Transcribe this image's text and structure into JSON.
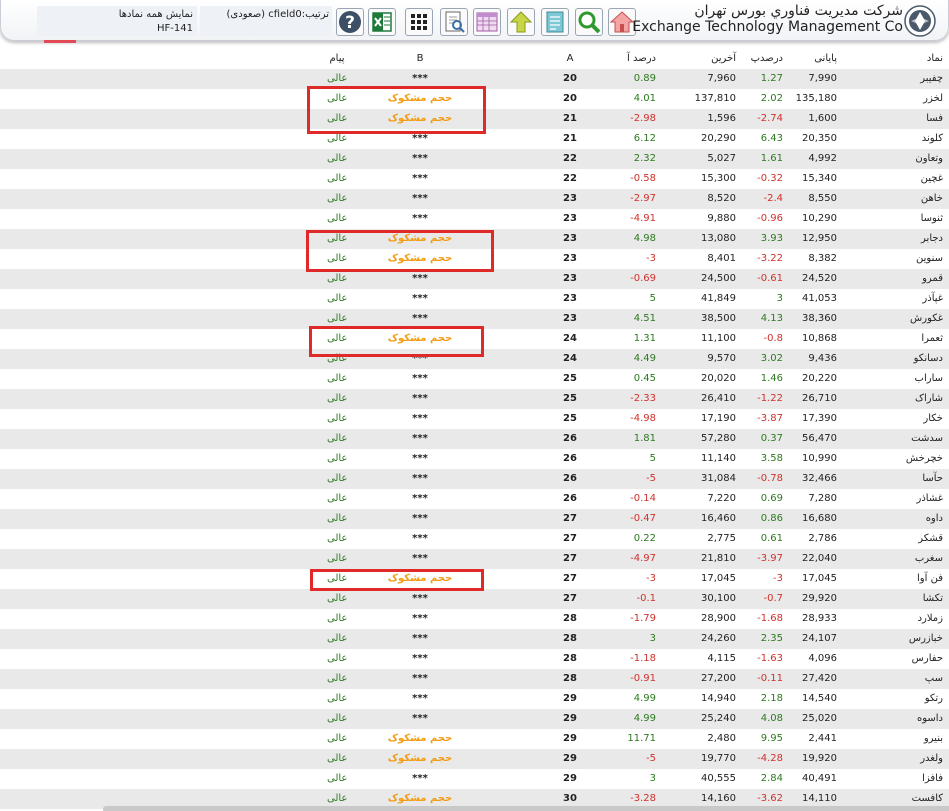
{
  "header": {
    "company_fa": "شرکت مديريت فناوري بورس تهران",
    "company_en": "Exchange Technology Management Co",
    "show_all_label": "نمایش همه نمادها",
    "report_code": "HF-141",
    "sort_label": "ترتیب:cfield0 (صعودی)",
    "toolbar": [
      "help-icon",
      "excel-icon",
      "grid-icon",
      "print-preview-icon",
      "calendar-table-icon",
      "upload-icon",
      "notes-icon",
      "search-icon",
      "home-icon"
    ]
  },
  "columns": {
    "symbol": "نماد",
    "close": "پایانی",
    "close_pct": "درصدپ",
    "last": "آخرین",
    "last_pct": "درصد آ",
    "a": "A",
    "b": "B",
    "message": "پیام"
  },
  "colors": {
    "positive": "#2d7a1f",
    "negative": "#d0312d",
    "flag": "#f39c12",
    "highlight": "#e02a2a"
  },
  "rows": [
    {
      "symbol": "چفیبر",
      "close": "7,990",
      "close_pct": "1.27",
      "last": "7,960",
      "last_pct": "0.89",
      "a": "20",
      "b": "***",
      "message": "عالی"
    },
    {
      "symbol": "لخزر",
      "close": "135,180",
      "close_pct": "2.02",
      "last": "137,810",
      "last_pct": "4.01",
      "a": "20",
      "b": "حجم مشکوک",
      "message": "عالی"
    },
    {
      "symbol": "فسا",
      "close": "1,600",
      "close_pct": "-2.74",
      "last": "1,596",
      "last_pct": "-2.98",
      "a": "21",
      "b": "حجم مشکوک",
      "message": "عالی"
    },
    {
      "symbol": "کلوند",
      "close": "20,350",
      "close_pct": "6.43",
      "last": "20,290",
      "last_pct": "6.12",
      "a": "21",
      "b": "***",
      "message": "عالی"
    },
    {
      "symbol": "وتعاون",
      "close": "4,992",
      "close_pct": "1.61",
      "last": "5,027",
      "last_pct": "2.32",
      "a": "22",
      "b": "***",
      "message": "عالی"
    },
    {
      "symbol": "غچین",
      "close": "15,340",
      "close_pct": "-0.32",
      "last": "15,300",
      "last_pct": "-0.58",
      "a": "22",
      "b": "***",
      "message": "عالی"
    },
    {
      "symbol": "خاهن",
      "close": "8,550",
      "close_pct": "-2.4",
      "last": "8,520",
      "last_pct": "-2.97",
      "a": "23",
      "b": "***",
      "message": "عالی"
    },
    {
      "symbol": "ثنوسا",
      "close": "10,290",
      "close_pct": "-0.96",
      "last": "9,880",
      "last_pct": "-4.91",
      "a": "23",
      "b": "***",
      "message": "عالی"
    },
    {
      "symbol": "دجابر",
      "close": "12,950",
      "close_pct": "3.93",
      "last": "13,080",
      "last_pct": "4.98",
      "a": "23",
      "b": "حجم مشکوک",
      "message": "عالی"
    },
    {
      "symbol": "سنوین",
      "close": "8,382",
      "close_pct": "-3.22",
      "last": "8,401",
      "last_pct": "-3",
      "a": "23",
      "b": "حجم مشکوک",
      "message": "عالی"
    },
    {
      "symbol": "قمرو",
      "close": "24,520",
      "close_pct": "-0.61",
      "last": "24,500",
      "last_pct": "-0.69",
      "a": "23",
      "b": "***",
      "message": "عالی"
    },
    {
      "symbol": "غپآذر",
      "close": "41,053",
      "close_pct": "3",
      "last": "41,849",
      "last_pct": "5",
      "a": "23",
      "b": "***",
      "message": "عالی"
    },
    {
      "symbol": "غکورش",
      "close": "38,360",
      "close_pct": "4.13",
      "last": "38,500",
      "last_pct": "4.51",
      "a": "23",
      "b": "***",
      "message": "عالی"
    },
    {
      "symbol": "ثعمرا",
      "close": "10,868",
      "close_pct": "-0.8",
      "last": "11,100",
      "last_pct": "1.31",
      "a": "24",
      "b": "حجم مشکوک",
      "message": "عالی"
    },
    {
      "symbol": "دسانکو",
      "close": "9,436",
      "close_pct": "3.02",
      "last": "9,570",
      "last_pct": "4.49",
      "a": "24",
      "b": "***",
      "message": "عالی"
    },
    {
      "symbol": "ساراب",
      "close": "20,220",
      "close_pct": "1.46",
      "last": "20,020",
      "last_pct": "0.45",
      "a": "25",
      "b": "***",
      "message": "عالی"
    },
    {
      "symbol": "شاراک",
      "close": "26,710",
      "close_pct": "-1.22",
      "last": "26,410",
      "last_pct": "-2.33",
      "a": "25",
      "b": "***",
      "message": "عالی"
    },
    {
      "symbol": "خکار",
      "close": "17,390",
      "close_pct": "-3.87",
      "last": "17,190",
      "last_pct": "-4.98",
      "a": "25",
      "b": "***",
      "message": "عالی"
    },
    {
      "symbol": "سدشت",
      "close": "56,470",
      "close_pct": "0.37",
      "last": "57,280",
      "last_pct": "1.81",
      "a": "26",
      "b": "***",
      "message": "عالی"
    },
    {
      "symbol": "خچرخش",
      "close": "10,990",
      "close_pct": "3.58",
      "last": "11,140",
      "last_pct": "5",
      "a": "26",
      "b": "***",
      "message": "عالی"
    },
    {
      "symbol": "حآسا",
      "close": "32,466",
      "close_pct": "-0.78",
      "last": "31,084",
      "last_pct": "-5",
      "a": "26",
      "b": "***",
      "message": "عالی"
    },
    {
      "symbol": "غشاذر",
      "close": "7,280",
      "close_pct": "0.69",
      "last": "7,220",
      "last_pct": "-0.14",
      "a": "26",
      "b": "***",
      "message": "عالی"
    },
    {
      "symbol": "داوه",
      "close": "16,680",
      "close_pct": "0.86",
      "last": "16,460",
      "last_pct": "-0.47",
      "a": "27",
      "b": "***",
      "message": "عالی"
    },
    {
      "symbol": "قشکر",
      "close": "2,786",
      "close_pct": "0.61",
      "last": "2,775",
      "last_pct": "0.22",
      "a": "27",
      "b": "***",
      "message": "عالی"
    },
    {
      "symbol": "سغرب",
      "close": "22,040",
      "close_pct": "-3.97",
      "last": "21,810",
      "last_pct": "-4.97",
      "a": "27",
      "b": "***",
      "message": "عالی"
    },
    {
      "symbol": "فن آوا",
      "close": "17,045",
      "close_pct": "-3",
      "last": "17,045",
      "last_pct": "-3",
      "a": "27",
      "b": "حجم مشکوک",
      "message": "عالی"
    },
    {
      "symbol": "تکشا",
      "close": "29,920",
      "close_pct": "-0.7",
      "last": "30,100",
      "last_pct": "-0.1",
      "a": "27",
      "b": "***",
      "message": "عالی"
    },
    {
      "symbol": "زملارد",
      "close": "28,933",
      "close_pct": "-1.68",
      "last": "28,900",
      "last_pct": "-1.79",
      "a": "28",
      "b": "***",
      "message": "عالی"
    },
    {
      "symbol": "خبازرس",
      "close": "24,107",
      "close_pct": "2.35",
      "last": "24,260",
      "last_pct": "3",
      "a": "28",
      "b": "***",
      "message": "عالی"
    },
    {
      "symbol": "حفارس",
      "close": "4,096",
      "close_pct": "-1.63",
      "last": "4,115",
      "last_pct": "-1.18",
      "a": "28",
      "b": "***",
      "message": "عالی"
    },
    {
      "symbol": "سپ",
      "close": "27,420",
      "close_pct": "-0.11",
      "last": "27,200",
      "last_pct": "-0.91",
      "a": "28",
      "b": "***",
      "message": "عالی"
    },
    {
      "symbol": "رتکو",
      "close": "14,540",
      "close_pct": "2.18",
      "last": "14,940",
      "last_pct": "4.99",
      "a": "29",
      "b": "***",
      "message": "عالی"
    },
    {
      "symbol": "داسوه",
      "close": "25,020",
      "close_pct": "4.08",
      "last": "25,240",
      "last_pct": "4.99",
      "a": "29",
      "b": "***",
      "message": "عالی"
    },
    {
      "symbol": "بنیرو",
      "close": "2,441",
      "close_pct": "9.95",
      "last": "2,480",
      "last_pct": "11.71",
      "a": "29",
      "b": "حجم مشکوک",
      "message": "عالی"
    },
    {
      "symbol": "ولغدر",
      "close": "19,920",
      "close_pct": "-4.28",
      "last": "19,770",
      "last_pct": "-5",
      "a": "29",
      "b": "حجم مشکوک",
      "message": "عالی"
    },
    {
      "symbol": "فافزا",
      "close": "40,491",
      "close_pct": "2.84",
      "last": "40,555",
      "last_pct": "3",
      "a": "29",
      "b": "***",
      "message": "عالی"
    },
    {
      "symbol": "کافست",
      "close": "14,110",
      "close_pct": "-3.62",
      "last": "14,160",
      "last_pct": "-3.28",
      "a": "30",
      "b": "حجم مشکوک",
      "message": "عالی"
    }
  ]
}
